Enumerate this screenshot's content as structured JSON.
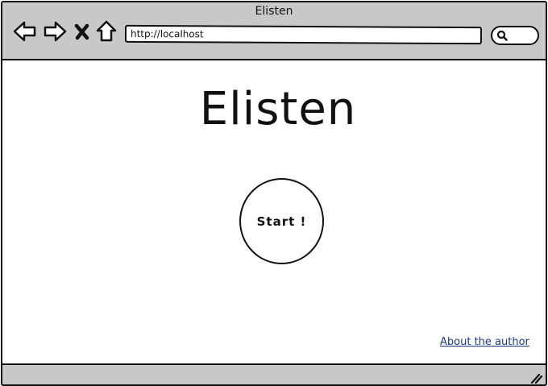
{
  "window": {
    "title": "Elisten"
  },
  "toolbar": {
    "back_icon": "back-arrow-icon",
    "forward_icon": "forward-arrow-icon",
    "stop_icon": "close-icon",
    "home_icon": "home-icon",
    "address_value": "http://localhost",
    "search_icon": "search-icon"
  },
  "main": {
    "heading": "Elisten",
    "start_button_label": "Start !",
    "about_link": "About the author"
  },
  "colors": {
    "chrome": "#c8c8c8",
    "outline": "#111111",
    "link": "#1a3a8a",
    "background": "#ffffff"
  }
}
